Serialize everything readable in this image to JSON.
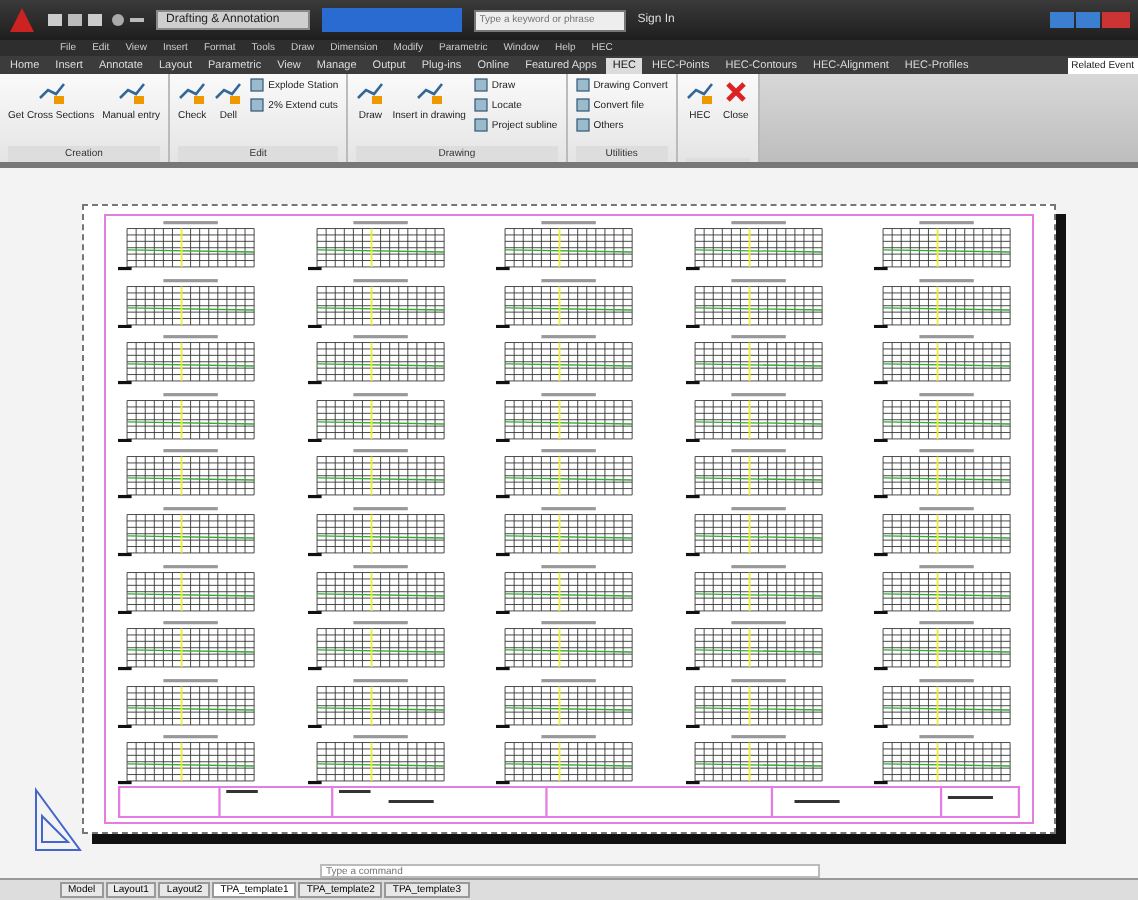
{
  "window": {
    "workspace": "Drafting & Annotation",
    "search": {
      "placeholder": "Type a keyword or phrase"
    },
    "sign_in": "Sign In"
  },
  "menu_bar": [
    "File",
    "Edit",
    "View",
    "Insert",
    "Format",
    "Tools",
    "Draw",
    "Dimension",
    "Modify",
    "Parametric",
    "Window",
    "Help",
    "HEC"
  ],
  "ribbon_tabs": [
    {
      "label": "Home",
      "selected": false
    },
    {
      "label": "Insert",
      "selected": false
    },
    {
      "label": "Annotate",
      "selected": false
    },
    {
      "label": "Layout",
      "selected": false
    },
    {
      "label": "Parametric",
      "selected": false
    },
    {
      "label": "View",
      "selected": false
    },
    {
      "label": "Manage",
      "selected": false
    },
    {
      "label": "Output",
      "selected": false
    },
    {
      "label": "Plug-ins",
      "selected": false
    },
    {
      "label": "Online",
      "selected": false
    },
    {
      "label": "Featured Apps",
      "selected": false
    },
    {
      "label": "HEC",
      "selected": true
    },
    {
      "label": "HEC-Points",
      "selected": false
    },
    {
      "label": "HEC-Contours",
      "selected": false
    },
    {
      "label": "HEC-Alignment",
      "selected": false
    },
    {
      "label": "HEC-Profiles",
      "selected": false
    }
  ],
  "side_label": "Related Event",
  "panels": [
    {
      "title": "Creation",
      "tools": [
        {
          "label": "Get Cross Sections",
          "kind": "large"
        },
        {
          "label": "Manual entry",
          "kind": "large"
        }
      ]
    },
    {
      "title": "Edit",
      "tools": [
        {
          "label": "Check",
          "kind": "large"
        },
        {
          "label": "Dell",
          "kind": "large"
        },
        {
          "label": "Explode Station",
          "kind": "small"
        },
        {
          "label": "2% Extend cuts",
          "kind": "small"
        }
      ]
    },
    {
      "title": "Drawing",
      "tools": [
        {
          "label": "Draw",
          "kind": "large"
        },
        {
          "label": "Insert in drawing",
          "kind": "large"
        },
        {
          "label": "Draw",
          "kind": "small"
        },
        {
          "label": "Locate",
          "kind": "small"
        },
        {
          "label": "Project subline",
          "kind": "small"
        }
      ]
    },
    {
      "title": "Utilities",
      "tools": [
        {
          "label": "Drawing Convert",
          "kind": "small"
        },
        {
          "label": "Convert file",
          "kind": "small"
        },
        {
          "label": "Others",
          "kind": "small"
        }
      ]
    },
    {
      "tools": [
        {
          "label": "HEC",
          "kind": "large"
        },
        {
          "label": "Close",
          "kind": "close"
        }
      ]
    }
  ],
  "command_line": {
    "placeholder": "Type a command"
  },
  "layout_tabs": [
    {
      "label": "Model",
      "selected": false
    },
    {
      "label": "Layout1",
      "selected": false
    },
    {
      "label": "Layout2",
      "selected": false
    },
    {
      "label": "TPA_template1",
      "selected": true
    },
    {
      "label": "TPA_template2",
      "selected": false
    },
    {
      "label": "TPA_template3",
      "selected": false
    }
  ]
}
